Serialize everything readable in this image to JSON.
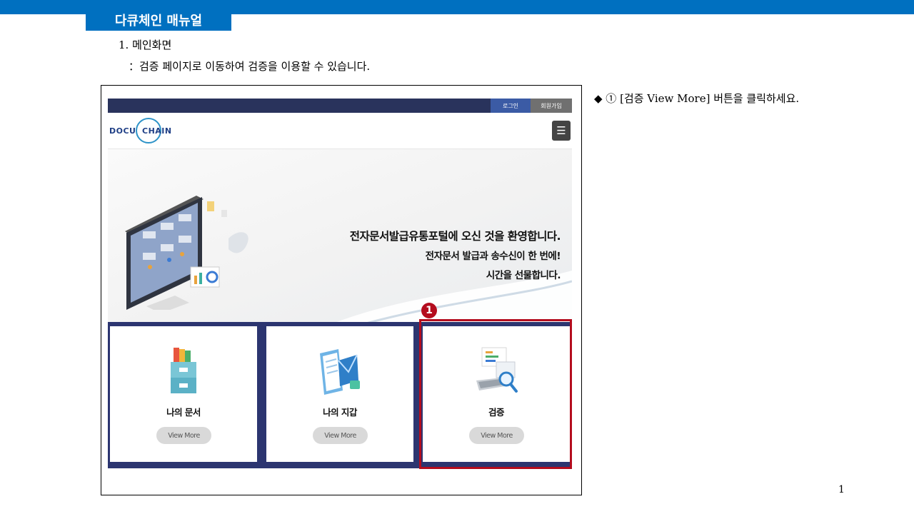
{
  "doc": {
    "manual_title": "다큐체인 매뉴얼",
    "section_heading": "1. 메인화면",
    "section_desc": "：검증 페이지로 이동하여 검증을 이용할 수 있습니다.",
    "instruction": "◆ ① [검증 View More] 버튼을 클릭하세요.",
    "marker_label": "1",
    "page_number": "1"
  },
  "site": {
    "login_label": "로그인",
    "signup_label": "회원가입",
    "logo_left": "DOCU",
    "logo_right": "CHAIN",
    "menu_icon": "☰",
    "hero": {
      "title": "전자문서발급유통포털에 오신 것을 환영합니다.",
      "subtitle_1": "전자문서 발급과 송수신이 한 번에!",
      "subtitle_2": "시간을 선물합니다."
    },
    "cards": [
      {
        "title": "나의 문서",
        "button": "View More",
        "icon": "document-box-icon"
      },
      {
        "title": "나의 지갑",
        "button": "View More",
        "icon": "wallet-mail-icon"
      },
      {
        "title": "검증",
        "button": "View More",
        "icon": "verify-computer-icon"
      }
    ]
  },
  "colors": {
    "brand_blue": "#0070c0",
    "highlight_red": "#b40d1e",
    "site_navy": "#29335c",
    "card_band": "#2c3570"
  }
}
